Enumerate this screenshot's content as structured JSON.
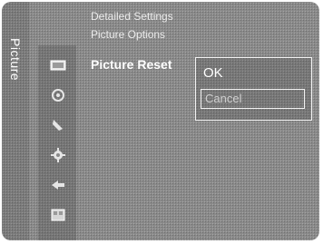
{
  "menu_title": "Picture",
  "breadcrumbs": [
    "Detailed Settings",
    "Picture Options"
  ],
  "current_item": "Picture Reset",
  "popup": {
    "options": [
      "OK",
      "Cancel"
    ],
    "selected_index": 1
  },
  "icons": [
    "picture-icon",
    "sound-icon",
    "channel-icon",
    "setup-icon",
    "input-icon",
    "application-icon"
  ],
  "colors": {
    "background": "#8a8a8a",
    "text": "#ffffff",
    "dim_text": "#cfcfcf"
  }
}
